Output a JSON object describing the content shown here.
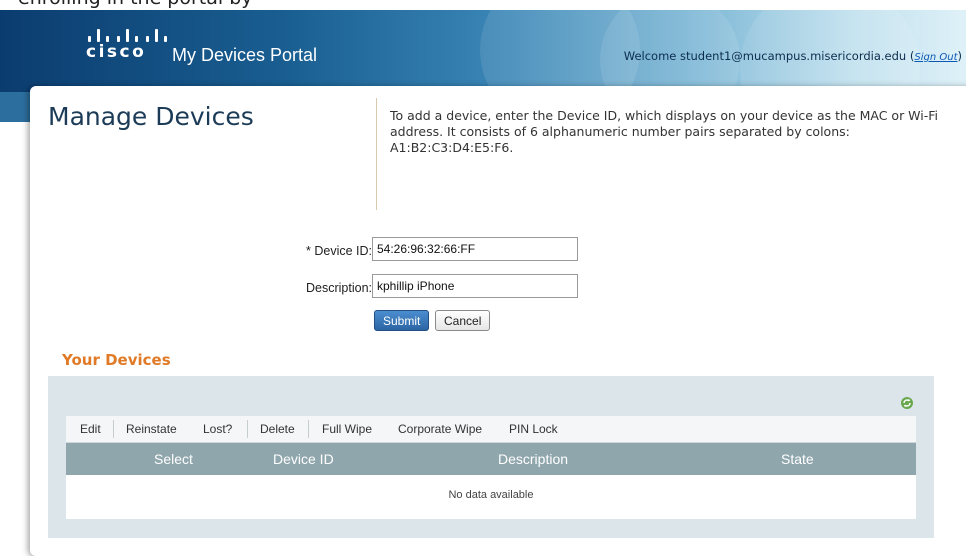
{
  "top_strip_text": "enrolling in the portal by",
  "header": {
    "logo_text": "cisco",
    "portal_title": "My Devices Portal",
    "welcome_text": "Welcome student1@mucampus.misericordia.edu (",
    "sign_out_label": "Sign Out",
    "welcome_close": ")"
  },
  "main": {
    "page_title": "Manage Devices",
    "instructions": "To add a device, enter the Device ID, which displays on your device as the MAC or Wi-Fi address. It consists of 6 alphanumeric number pairs separated by colons: A1:B2:C3:D4:E5:F6."
  },
  "form": {
    "device_id_label": "* Device ID:",
    "device_id_value": "54:26:96:32:66:FF",
    "description_label": "Description:",
    "description_value": "kphillip iPhone",
    "submit_label": "Submit",
    "cancel_label": "Cancel"
  },
  "devices": {
    "section_title": "Your Devices",
    "toolbar": {
      "edit": "Edit",
      "reinstate": "Reinstate",
      "lost": "Lost?",
      "delete": "Delete",
      "full_wipe": "Full Wipe",
      "corporate_wipe": "Corporate Wipe",
      "pin_lock": "PIN Lock"
    },
    "columns": {
      "select": "Select",
      "device_id": "Device ID",
      "description": "Description",
      "state": "State"
    },
    "empty_message": "No data available",
    "refresh_icon": "refresh-icon"
  },
  "colors": {
    "header_dark": "#0b3c6f",
    "accent_orange": "#e07a26",
    "table_header": "#8fa6ad",
    "panel_bg": "#dce6ea",
    "submit_blue": "#2c65a4"
  }
}
